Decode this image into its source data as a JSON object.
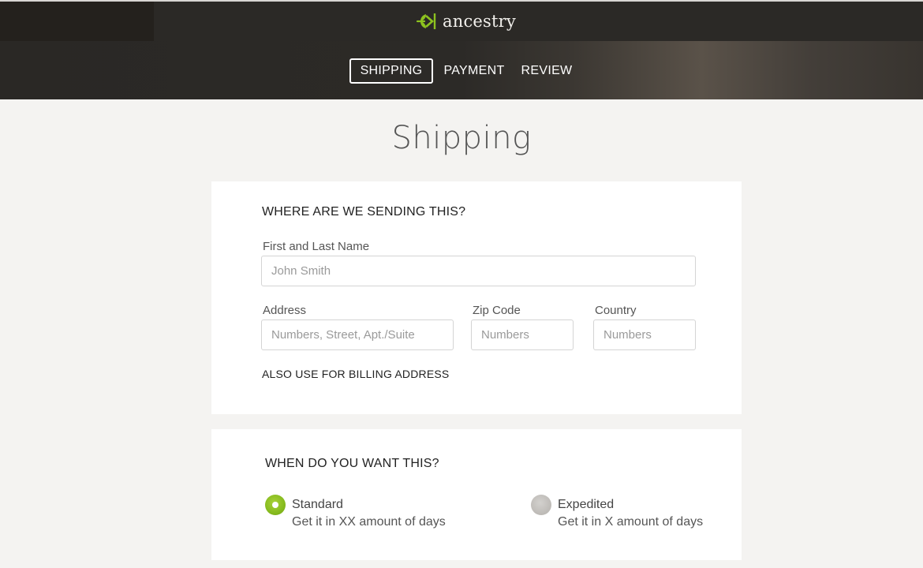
{
  "brand": {
    "name": "ancestry"
  },
  "nav": {
    "steps": [
      {
        "label": "SHIPPING",
        "active": true
      },
      {
        "label": "PAYMENT",
        "active": false
      },
      {
        "label": "REVIEW",
        "active": false
      }
    ]
  },
  "page": {
    "title": "Shipping"
  },
  "shipping_form": {
    "heading": "WHERE ARE WE SENDING THIS?",
    "name": {
      "label": "First and Last Name",
      "placeholder": "John Smith",
      "value": ""
    },
    "address": {
      "label": "Address",
      "placeholder": "Numbers, Street, Apt./Suite",
      "value": ""
    },
    "zip": {
      "label": "Zip Code",
      "placeholder": "Numbers",
      "value": ""
    },
    "country": {
      "label": "Country",
      "placeholder": "Numbers",
      "value": ""
    },
    "billing_link": "ALSO USE FOR BILLING ADDRESS"
  },
  "delivery": {
    "heading": "WHEN DO YOU WANT THIS?",
    "options": [
      {
        "title": "Standard",
        "subtitle": "Get it in XX amount of days",
        "selected": true
      },
      {
        "title": "Expedited",
        "subtitle": "Get it in X amount of days",
        "selected": false
      }
    ]
  },
  "colors": {
    "accent_green": "#86bb1e",
    "header_dark": "#2b2926",
    "page_bg": "#f4f3f1"
  },
  "icons": {
    "logo": "leaf-logo-icon",
    "radio_on": "radio-selected-icon",
    "radio_off": "radio-unselected-icon"
  }
}
